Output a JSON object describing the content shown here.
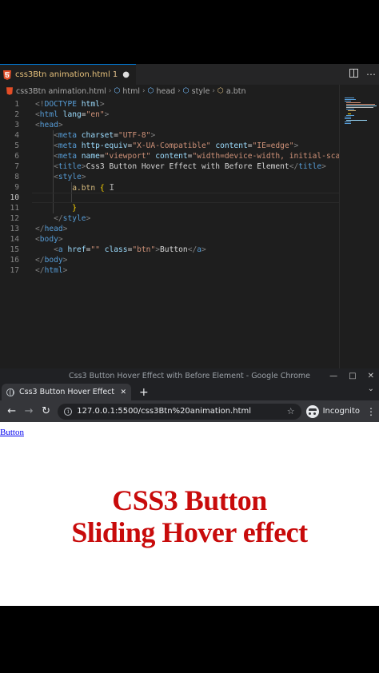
{
  "colors": {
    "accent_red": "#c80b0b",
    "editor_bg": "#1e1e1e",
    "chrome_bg": "#35363a"
  },
  "editor": {
    "tab": {
      "filename": "css3Btn animation.html",
      "modified_count": "1",
      "unsaved_dot": "●",
      "icon": "html5-icon"
    },
    "breadcrumb": {
      "file": "css3Btn animation.html",
      "html": "html",
      "head": "head",
      "style": "style",
      "selector": "a.btn"
    },
    "line_numbers": [
      "1",
      "2",
      "3",
      "4",
      "5",
      "6",
      "7",
      "8",
      "9",
      "10",
      "11",
      "12",
      "13",
      "14",
      "15",
      "16",
      "17"
    ],
    "active_line": "10"
  },
  "browser": {
    "window_title": "Css3 Button Hover Effect with Before Element - Google Chrome",
    "tab_title": "Css3 Button Hover Effect wi",
    "url": "127.0.0.1:5500/css3Btn%20animation.html",
    "profile_label": "Incognito",
    "page_link_text": "Button"
  },
  "caption": {
    "line1": "CSS3 Button",
    "line2": "Sliding Hover effect"
  }
}
